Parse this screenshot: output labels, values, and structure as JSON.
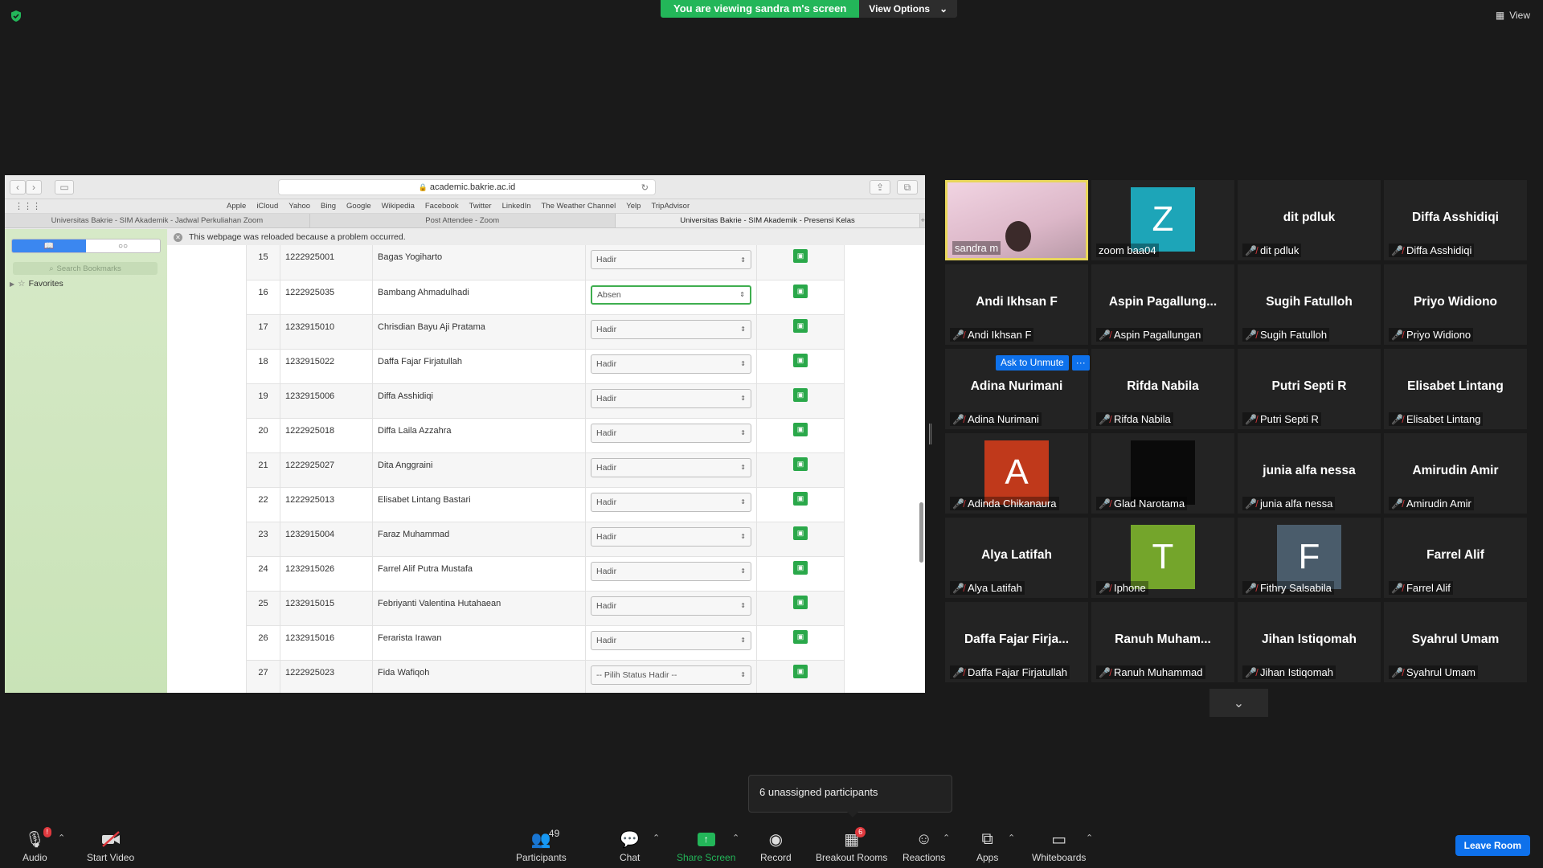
{
  "top": {
    "viewing_text": "You are viewing sandra m's screen",
    "view_options": "View Options",
    "view": "View"
  },
  "browser": {
    "url": "academic.bakrie.ac.id",
    "bookmarks": [
      "Apple",
      "iCloud",
      "Yahoo",
      "Bing",
      "Google",
      "Wikipedia",
      "Facebook",
      "Twitter",
      "LinkedIn",
      "The Weather Channel",
      "Yelp",
      "TripAdvisor"
    ],
    "tabs": [
      "Universitas Bakrie - SIM Akademik - Jadwal Perkuliahan Zoom",
      "Post Attendee - Zoom",
      "Universitas Bakrie - SIM Akademik - Presensi Kelas"
    ],
    "sidebar_search": "Search Bookmarks",
    "favorites": "Favorites",
    "notice": "This webpage was reloaded because a problem occurred.",
    "rows": [
      {
        "no": "15",
        "nim": "1222925001",
        "name": "Bagas Yogiharto",
        "status": "Hadir"
      },
      {
        "no": "16",
        "nim": "1222925035",
        "name": "Bambang Ahmadulhadi",
        "status": "Absen"
      },
      {
        "no": "17",
        "nim": "1232915010",
        "name": "Chrisdian Bayu Aji Pratama",
        "status": "Hadir"
      },
      {
        "no": "18",
        "nim": "1232915022",
        "name": "Daffa Fajar Firjatullah",
        "status": "Hadir"
      },
      {
        "no": "19",
        "nim": "1232915006",
        "name": "Diffa Asshidiqi",
        "status": "Hadir"
      },
      {
        "no": "20",
        "nim": "1222925018",
        "name": "Diffa Laila Azzahra",
        "status": "Hadir"
      },
      {
        "no": "21",
        "nim": "1222925027",
        "name": "Dita Anggraini",
        "status": "Hadir"
      },
      {
        "no": "22",
        "nim": "1222925013",
        "name": "Elisabet Lintang Bastari",
        "status": "Hadir"
      },
      {
        "no": "23",
        "nim": "1232915004",
        "name": "Faraz Muhammad",
        "status": "Hadir"
      },
      {
        "no": "24",
        "nim": "1232915026",
        "name": "Farrel Alif Putra Mustafa",
        "status": "Hadir"
      },
      {
        "no": "25",
        "nim": "1232915015",
        "name": "Febriyanti Valentina Hutahaean",
        "status": "Hadir"
      },
      {
        "no": "26",
        "nim": "1232915016",
        "name": "Ferarista Irawan",
        "status": "Hadir"
      },
      {
        "no": "27",
        "nim": "1222925023",
        "name": "Fida Wafiqoh",
        "status": "-- Pilih Status Hadir --"
      }
    ]
  },
  "gallery": [
    {
      "big": "",
      "label": "sandra m",
      "type": "video",
      "muted": false
    },
    {
      "big": "",
      "label": "zoom baa04",
      "type": "avatar",
      "letter": "Z",
      "color": "#1da5b8",
      "muted": false
    },
    {
      "big": "dit pdluk",
      "label": "dit pdluk",
      "type": "name",
      "muted": true
    },
    {
      "big": "Diffa Asshidiqi",
      "label": "Diffa Asshidiqi",
      "type": "name",
      "muted": true
    },
    {
      "big": "Andi Ikhsan F",
      "label": "Andi Ikhsan F",
      "type": "name",
      "muted": true
    },
    {
      "big": "Aspin  Pagallung...",
      "label": "Aspin Pagallungan",
      "type": "name",
      "muted": true
    },
    {
      "big": "Sugih Fatulloh",
      "label": "Sugih Fatulloh",
      "type": "name",
      "muted": true
    },
    {
      "big": "Priyo Widiono",
      "label": "Priyo Widiono",
      "type": "name",
      "muted": true
    },
    {
      "big": "Adina Nurimani",
      "label": "Adina Nurimani",
      "type": "name",
      "muted": true
    },
    {
      "big": "Rifda Nabila",
      "label": "Rifda Nabila",
      "type": "name",
      "muted": true
    },
    {
      "big": "Putri Septi R",
      "label": "Putri Septi R",
      "type": "name",
      "muted": true
    },
    {
      "big": "Elisabet Lintang",
      "label": "Elisabet Lintang",
      "type": "name",
      "muted": true
    },
    {
      "big": "",
      "label": "Adinda Chikanaura",
      "type": "avatar",
      "letter": "A",
      "color": "#c0391b",
      "muted": true
    },
    {
      "big": "",
      "label": "Glad Narotama",
      "type": "avatar",
      "letter": "",
      "color": "#0a0a0a",
      "muted": true
    },
    {
      "big": "junia alfa nessa",
      "label": "junia alfa nessa",
      "type": "name",
      "muted": true
    },
    {
      "big": "Amirudin Amir",
      "label": "Amirudin Amir",
      "type": "name",
      "muted": true
    },
    {
      "big": "Alya Latifah",
      "label": "Alya Latifah",
      "type": "name",
      "muted": true
    },
    {
      "big": "",
      "label": "Iphone",
      "type": "avatar",
      "letter": "T",
      "color": "#74a52b",
      "muted": true
    },
    {
      "big": "",
      "label": "Fithry Salsabila",
      "type": "avatar",
      "letter": "F",
      "color": "#4a5c6b",
      "muted": true
    },
    {
      "big": "Farrel Alif",
      "label": "Farrel Alif",
      "type": "name",
      "muted": true
    },
    {
      "big": "Daffa  Fajar  Firja...",
      "label": "Daffa Fajar Firjatullah",
      "type": "name",
      "muted": true
    },
    {
      "big": "Ranuh  Muham...",
      "label": "Ranuh Muhammad",
      "type": "name",
      "muted": true
    },
    {
      "big": "Jihan Istiqomah",
      "label": "Jihan Istiqomah",
      "type": "name",
      "muted": true
    },
    {
      "big": "Syahrul Umam",
      "label": "Syahrul Umam",
      "type": "name",
      "muted": true
    }
  ],
  "ask_unmute": "Ask to Unmute",
  "ask_more": "···",
  "popup": "6 unassigned participants",
  "toolbar": {
    "audio": "Audio",
    "audio_badge": "!",
    "start_video": "Start Video",
    "participants": "Participants",
    "participants_count": "49",
    "chat": "Chat",
    "share_screen": "Share Screen",
    "record": "Record",
    "breakout_rooms": "Breakout Rooms",
    "breakout_badge": "6",
    "reactions": "Reactions",
    "apps": "Apps",
    "whiteboards": "Whiteboards",
    "leave_room": "Leave Room"
  }
}
